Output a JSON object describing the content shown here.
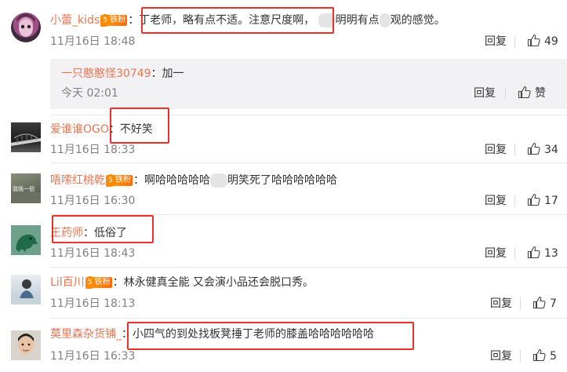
{
  "comments": [
    {
      "username": "小蕾_kids",
      "badge_level": "5",
      "badge_label": "铁粉",
      "text_before": "丁老师，略有点不适。注意尺度啊，",
      "text_middle": "明明有点",
      "text_after": "观的感觉。",
      "date": "11月16日 18:48",
      "reply_label": "回复",
      "likes": "49",
      "sub_reply": {
        "username": "一只憨憨怪30749",
        "text": "加一",
        "date": "今天 02:01",
        "reply_label": "回复",
        "like_label": "赞"
      }
    },
    {
      "username": "爱谁谁OGO",
      "text": "不好笑",
      "date": "11月16日 18:33",
      "reply_label": "回复",
      "likes": "34"
    },
    {
      "username": "唔嗦红桃乾",
      "badge_level": "5",
      "badge_label": "铁粉",
      "text_before": "啊哈哈哈哈哈",
      "text_after": "明笑死了哈哈哈哈哈哈",
      "date": "11月16日 16:30",
      "reply_label": "回复",
      "likes": "17",
      "avatar_text": "我晚一個"
    },
    {
      "username": "王药师",
      "text": "低俗了",
      "date": "11月16日 18:43",
      "reply_label": "回复",
      "likes": "13"
    },
    {
      "username": "Lil百川",
      "badge_level": "5",
      "badge_label": "铁粉",
      "text": "林永健真全能 又会演小品还会脱口秀。",
      "date": "11月16日 18:13",
      "reply_label": "回复",
      "likes": "7"
    },
    {
      "username": "莫里森杂货铺_",
      "text": "小四气的到处找板凳捶丁老师的膝盖哈哈哈哈哈哈",
      "date": "11月16日 16:33",
      "reply_label": "回复",
      "likes": "5"
    }
  ],
  "colors": {
    "username": "#eb7350",
    "highlight_box": "#e8312b",
    "meta": "#808080",
    "sub_reply_bg": "#f2f2f5"
  },
  "icons": [
    "thumbs-up-icon",
    "iron-fan-badge-icon",
    "avatar"
  ]
}
